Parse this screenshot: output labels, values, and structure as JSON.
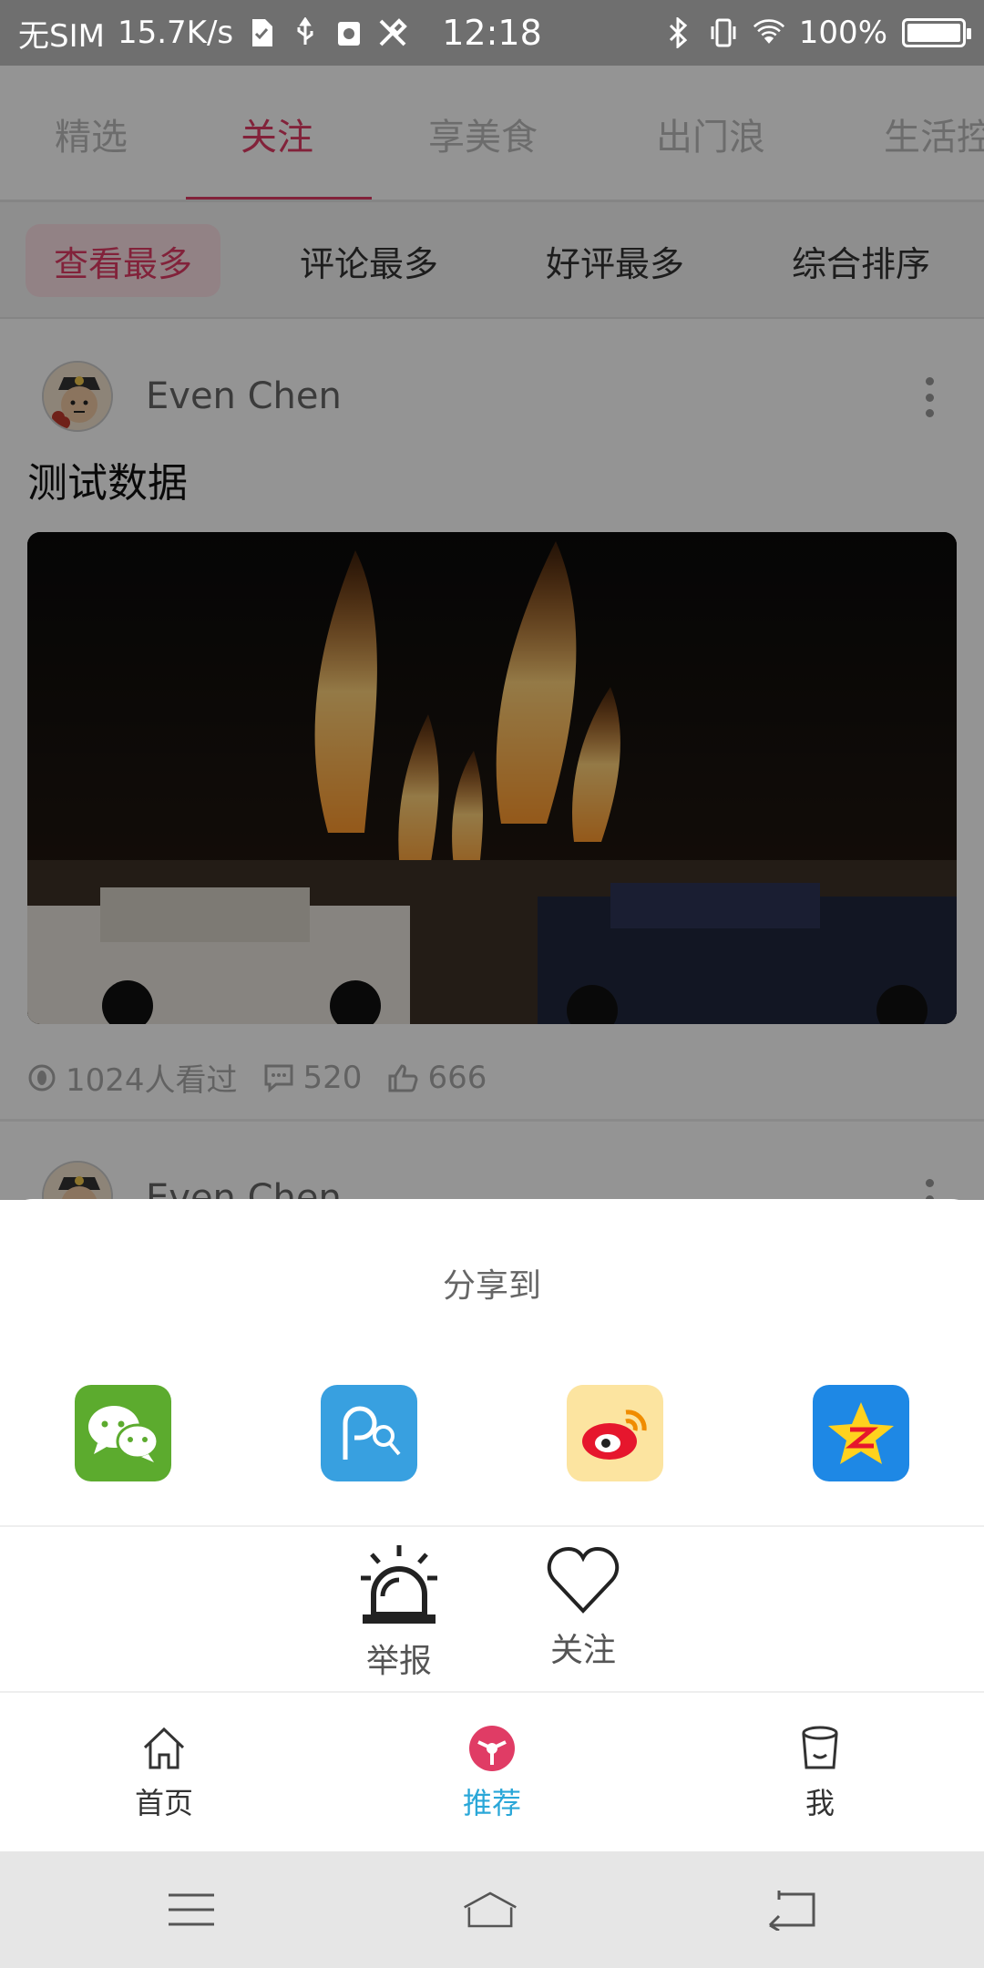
{
  "status": {
    "carrier": "无SIM",
    "speed": "15.7K/s",
    "time": "12:18",
    "battery": "100%",
    "battery_level": 1.0
  },
  "top_tabs": [
    "精选",
    "关注",
    "享美食",
    "出门浪",
    "生活控"
  ],
  "active_tab": "关注",
  "sort_options": [
    "查看最多",
    "评论最多",
    "好评最多",
    "综合排序"
  ],
  "active_sort": "查看最多",
  "posts": [
    {
      "author": "Even Chen",
      "title": "测试数据",
      "views": "1024人看过",
      "comments": "520",
      "likes": "666"
    },
    {
      "author": "Even Chen"
    }
  ],
  "share": {
    "title": "分享到",
    "targets": [
      "wechat-icon",
      "pengyouquan-icon",
      "weibo-icon",
      "qzone-icon"
    ],
    "actions": [
      {
        "label": "举报",
        "icon": "alarm-icon"
      },
      {
        "label": "关注",
        "icon": "heart-icon"
      }
    ]
  },
  "bottom_nav": [
    {
      "label": "首页",
      "icon": "home-icon"
    },
    {
      "label": "推荐",
      "icon": "recommend-icon",
      "active": true
    },
    {
      "label": "我",
      "icon": "profile-icon"
    }
  ],
  "colors": {
    "accent": "#e03c65",
    "nav_active": "#2aa7d8"
  }
}
